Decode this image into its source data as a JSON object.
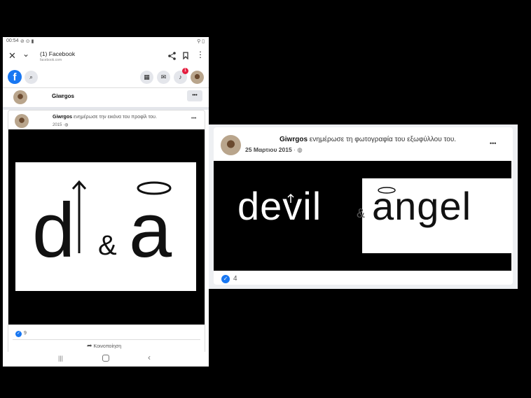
{
  "phone": {
    "status": {
      "time": "00:54",
      "left_icons": "⊘ ⊙ ▮",
      "right_icons": "⚲ ▯"
    },
    "browser": {
      "tab_title": "(1) Facebook",
      "url": "facebook.com"
    },
    "fb": {
      "notif_count": "1"
    },
    "profile": {
      "name": "Giwrgos"
    },
    "post": {
      "author": "Giwrgos",
      "action": "ενημέρωσε την εικόνα του προφίλ του.",
      "date": "2015",
      "logo_text": {
        "d": "d",
        "amp": "&",
        "a": "a"
      },
      "like_count": "9",
      "share_label": "Κοινοποίηση"
    }
  },
  "desktop_post": {
    "author": "Giwrgos",
    "action": "ενημέρωσε τη φωτογραφία του εξωφύλλου του.",
    "date": "25 Μαρτιου 2015",
    "logo_text": {
      "devil": "devil",
      "amp": "&",
      "angel": "angel"
    },
    "like_count": "4",
    "more_label": "•••"
  },
  "colors": {
    "facebook_blue": "#1877f2",
    "notif_red": "#e41e3f",
    "icon_bg": "#e4e6eb"
  }
}
